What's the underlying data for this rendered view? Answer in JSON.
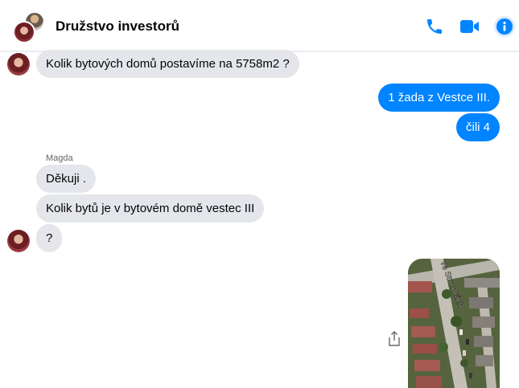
{
  "header": {
    "title": "Družstvo investorů",
    "actions": [
      "phone-icon",
      "video-icon",
      "info-icon"
    ],
    "accent_color": "#0084ff"
  },
  "messages": {
    "m1": "Kolik bytových domů postavíme na 5758m2 ?",
    "m2": "1 žada z Vestce III.",
    "m3": "čili 4",
    "sender_name": "Magda",
    "m4": "Děkuji .",
    "m5": "Kolik bytů je v bytovém domě vestec III",
    "m6": "?"
  },
  "map_image": {
    "street_label": "Ve Stromkách"
  },
  "colors": {
    "incoming_bubble": "#e4e6eb",
    "outgoing_bubble": "#0084ff"
  }
}
